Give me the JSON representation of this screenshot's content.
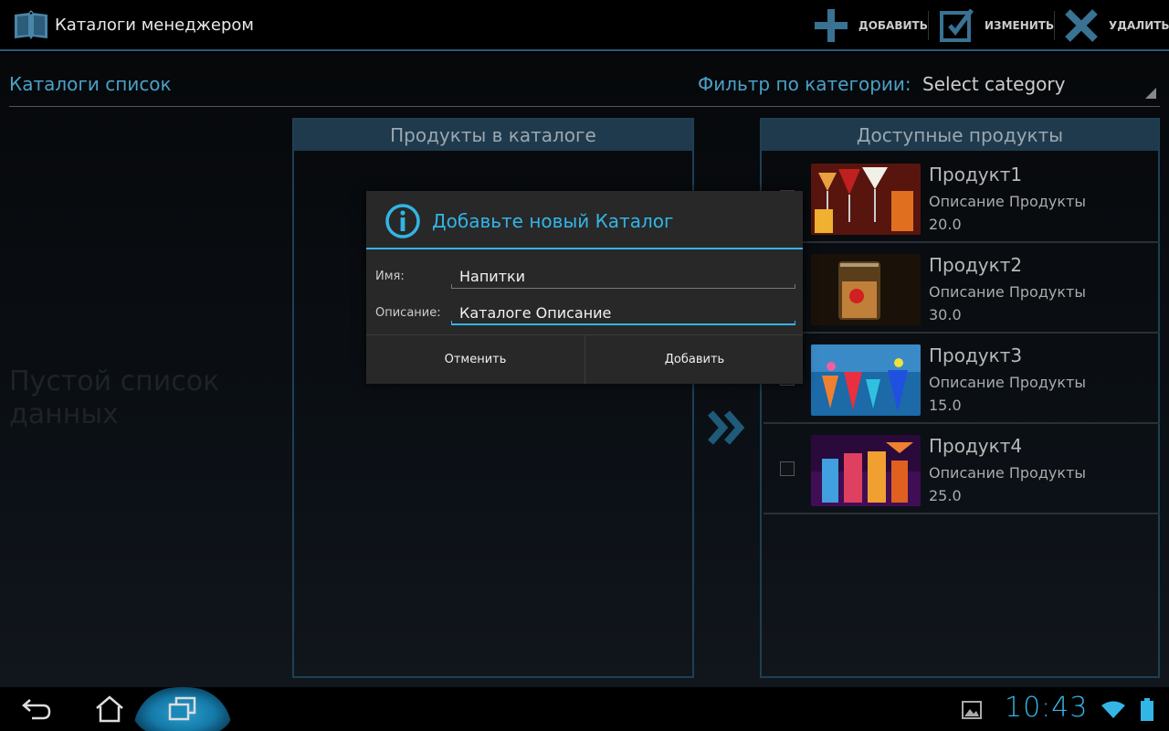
{
  "app": {
    "title": "Каталоги менеджером",
    "actions": [
      {
        "label": "ДОБАВИТЬ",
        "icon": "plus-icon"
      },
      {
        "label": "ИЗМЕНИТЬ",
        "icon": "edit-icon"
      },
      {
        "label": "УДАЛИТЬ",
        "icon": "close-icon"
      }
    ]
  },
  "main": {
    "list_title": "Каталоги список",
    "filter_label": "Фильтр по категории:",
    "filter_value": "Select category",
    "empty_text": "Пустой список данных",
    "catalog_panel_title": "Продукты в каталоге",
    "available_panel_title": "Доступные продукты",
    "products": [
      {
        "name": "Продукт1",
        "description": "Описание Продукты",
        "price": "20.0"
      },
      {
        "name": "Продукт2",
        "description": "Описание Продукты",
        "price": "30.0"
      },
      {
        "name": "Продукт3",
        "description": "Описание Продукты",
        "price": "15.0"
      },
      {
        "name": "Продукт4",
        "description": "Описание Продукты",
        "price": "25.0"
      }
    ]
  },
  "dialog": {
    "title": "Добавьте новый Каталог",
    "name_label": "Имя:",
    "name_value": "Напитки",
    "description_label": "Описание:",
    "description_value": "Каталоге Описание",
    "cancel_label": "Отменить",
    "add_label": "Добавить"
  },
  "status": {
    "clock": "10:43"
  },
  "colors": {
    "accent": "#33b5e5",
    "panel_header": "#1f3a4c"
  }
}
